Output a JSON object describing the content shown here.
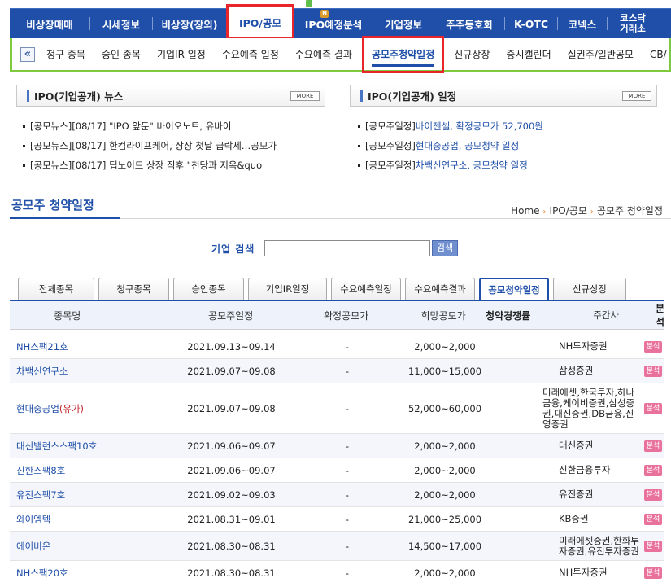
{
  "topnav": [
    {
      "label": "비상장매매",
      "active": false
    },
    {
      "label": "시세정보",
      "active": false
    },
    {
      "label": "비상장(장외)",
      "active": false
    },
    {
      "label": "IPO/공모",
      "active": true
    },
    {
      "label": "IPO예정분석",
      "active": false,
      "badge": "N"
    },
    {
      "label": "기업정보",
      "active": false
    },
    {
      "label": "주주동호회",
      "active": false
    },
    {
      "label": "K-OTC",
      "active": false
    },
    {
      "label": "코넥스",
      "active": false
    },
    {
      "label": "코스닥 거래소",
      "active": false
    }
  ],
  "subnav": [
    {
      "label": "청구 종목",
      "active": false
    },
    {
      "label": "승인 종목",
      "active": false
    },
    {
      "label": "기업IR 일정",
      "active": false
    },
    {
      "label": "수요예측 일정",
      "active": false
    },
    {
      "label": "수요예측 결과",
      "active": false
    },
    {
      "label": "공모주청약일정",
      "active": true
    },
    {
      "label": "신규상장",
      "active": false
    },
    {
      "label": "증시캘린더",
      "active": false
    },
    {
      "label": "실권주/일반공모",
      "active": false
    },
    {
      "label": "CB/",
      "active": false
    }
  ],
  "news_box": {
    "title": "IPO(기업공개) 뉴스",
    "more": "MORE",
    "items": [
      "[공모뉴스][08/17] \"IPO 앞둔\" 바이오노트, 유바이",
      "[공모뉴스][08/17] 한컴라이프케어, 상장 첫날 급락세…공모가",
      "[공모뉴스][08/17] 딥노이드 상장 직후 \"천당과 지옥&quo"
    ]
  },
  "schedule_box": {
    "title": "IPO(기업공개) 일정",
    "more": "MORE",
    "items": [
      {
        "prefix": "[공모주일정]",
        "text": "바이젠셀, 확정공모가 52,700원"
      },
      {
        "prefix": "[공모주일정]",
        "text": "현대중공업, 공모청약 일정"
      },
      {
        "prefix": "[공모주일정]",
        "text": "차백신연구소, 공모청약 일정"
      }
    ]
  },
  "page": {
    "title": "공모주 청약일정",
    "breadcrumb": [
      "Home",
      "IPO/공모",
      "공모주 청약일정"
    ]
  },
  "search": {
    "label": "기업 검색",
    "value": "",
    "button": "검색"
  },
  "tabs": [
    {
      "label": "전체종목",
      "active": false
    },
    {
      "label": "청구종목",
      "active": false
    },
    {
      "label": "승인종목",
      "active": false
    },
    {
      "label": "기업IR일정",
      "active": false
    },
    {
      "label": "수요예측일정",
      "active": false
    },
    {
      "label": "수요예측결과",
      "active": false
    },
    {
      "label": "공모청약일정",
      "active": true
    },
    {
      "label": "신규상장",
      "active": false
    }
  ],
  "table": {
    "headers": {
      "name": "종목명",
      "period": "공모주일정",
      "fixed": "확정공모가",
      "desired": "희망공모가",
      "rate": "청약경쟁률",
      "underwriter": "주간사",
      "analysis": "분석"
    },
    "analysis_label": "분석",
    "rows": [
      {
        "name": "NH스팩21호",
        "suffix": "",
        "period": "2021.09.13~09.14",
        "fixed": "-",
        "desired": "2,000~2,000",
        "rate": "",
        "underwriter": "NH투자증권"
      },
      {
        "name": "차백신연구소",
        "suffix": "",
        "period": "2021.09.07~09.08",
        "fixed": "-",
        "desired": "11,000~15,000",
        "rate": "",
        "underwriter": "삼성증권"
      },
      {
        "name": "현대중공업",
        "suffix": "(유가)",
        "period": "2021.09.07~09.08",
        "fixed": "-",
        "desired": "52,000~60,000",
        "rate": "",
        "underwriter": "미래에셋,한국투자,하나금융,케이비증권,삼성증권,대신증권,DB금융,신영증권"
      },
      {
        "name": "대신밸런스스팩10호",
        "suffix": "",
        "period": "2021.09.06~09.07",
        "fixed": "-",
        "desired": "2,000~2,000",
        "rate": "",
        "underwriter": "대신증권"
      },
      {
        "name": "신한스팩8호",
        "suffix": "",
        "period": "2021.09.06~09.07",
        "fixed": "-",
        "desired": "2,000~2,000",
        "rate": "",
        "underwriter": "신한금융투자"
      },
      {
        "name": "유진스팩7호",
        "suffix": "",
        "period": "2021.09.02~09.03",
        "fixed": "-",
        "desired": "2,000~2,000",
        "rate": "",
        "underwriter": "유진증권"
      },
      {
        "name": "와이엠텍",
        "suffix": "",
        "period": "2021.08.31~09.01",
        "fixed": "-",
        "desired": "21,000~25,000",
        "rate": "",
        "underwriter": "KB증권"
      },
      {
        "name": "에이비온",
        "suffix": "",
        "period": "2021.08.30~08.31",
        "fixed": "-",
        "desired": "14,500~17,000",
        "rate": "",
        "underwriter": "미래에셋증권,한화투자증권,유진투자증권"
      },
      {
        "name": "NH스팩20호",
        "suffix": "",
        "period": "2021.08.30~08.31",
        "fixed": "-",
        "desired": "2,000~2,000",
        "rate": "",
        "underwriter": "NH투자증권"
      }
    ]
  }
}
